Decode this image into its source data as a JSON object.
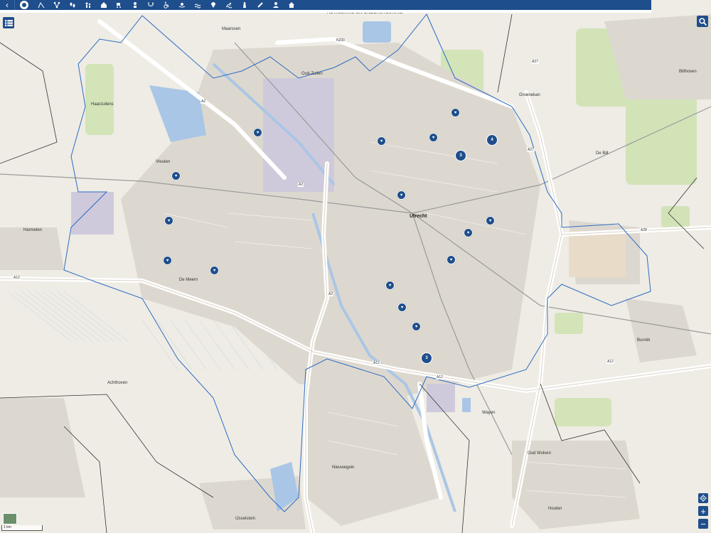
{
  "topbar": {
    "back_icon": "chevron-left-icon",
    "categories": [
      {
        "icon": "support-icon",
        "active": true
      },
      {
        "icon": "slide-icon"
      },
      {
        "icon": "network-icon"
      },
      {
        "icon": "footsteps-icon"
      },
      {
        "icon": "family-icon"
      },
      {
        "icon": "shelter-icon"
      },
      {
        "icon": "pram-icon"
      },
      {
        "icon": "person-icon"
      },
      {
        "icon": "stethoscope-icon"
      },
      {
        "icon": "wheelchair-icon"
      },
      {
        "icon": "care-icon"
      },
      {
        "icon": "wave-icon"
      },
      {
        "icon": "pin-icon"
      },
      {
        "icon": "swimmer-icon"
      },
      {
        "icon": "tower-icon"
      },
      {
        "icon": "pencil-icon"
      },
      {
        "icon": "user-icon"
      },
      {
        "icon": "home-icon"
      }
    ]
  },
  "map": {
    "banner": "ADVISERING EN ONDERSTEUNING",
    "places": [
      {
        "name": "Maarssen",
        "big": false
      },
      {
        "name": "Oud-Zuilen",
        "big": false
      },
      {
        "name": "Bilthoven",
        "big": false
      },
      {
        "name": "Groenekan",
        "big": false
      },
      {
        "name": "De Bilt",
        "big": false
      },
      {
        "name": "Vleuten",
        "big": false
      },
      {
        "name": "Utrecht",
        "big": true
      },
      {
        "name": "De Meern",
        "big": false
      },
      {
        "name": "Harmelen",
        "big": false
      },
      {
        "name": "Nieuwegein",
        "big": false
      },
      {
        "name": "IJsselstein",
        "big": false
      },
      {
        "name": "Houten",
        "big": false
      },
      {
        "name": "Bunnik",
        "big": false
      },
      {
        "name": "Achthoven",
        "big": false
      },
      {
        "name": "Haarzuilens",
        "big": false
      },
      {
        "name": "Oud Wulven",
        "big": false
      },
      {
        "name": "Wayen",
        "big": false
      }
    ],
    "roads": [
      "A2",
      "A2",
      "A12",
      "A12",
      "A12",
      "A27",
      "A27",
      "A28",
      "N230",
      "A2",
      "A12"
    ],
    "clusters": [
      "3",
      "4",
      "3"
    ]
  },
  "controls": {
    "list_icon": "list-icon",
    "search_icon": "search-icon",
    "locate_icon": "locate-icon",
    "zoom_in": "+",
    "zoom_out": "−",
    "scale": "1 km"
  },
  "colors": {
    "primary": "#1f4e8c",
    "boundary": "#2d6bc4"
  }
}
